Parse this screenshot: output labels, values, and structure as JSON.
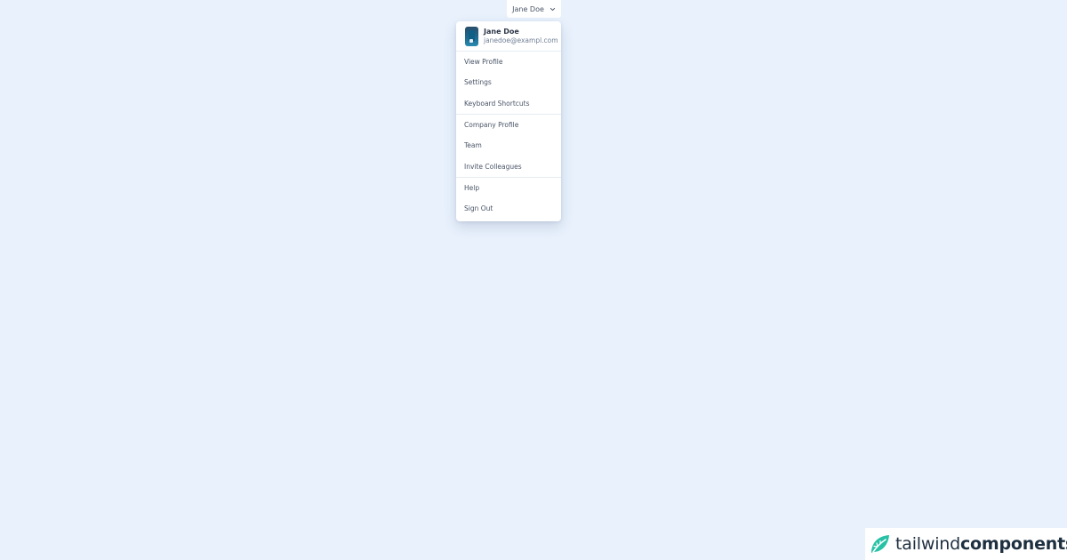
{
  "trigger": {
    "label": "Jane Doe",
    "icon": "chevron-down-icon"
  },
  "dropdown": {
    "user": {
      "name": "Jane Doe",
      "email": "janedoe@exampl.com"
    },
    "groups": [
      {
        "items": [
          {
            "label": "View Profile"
          },
          {
            "label": "Settings"
          },
          {
            "label": "Keyboard Shortcuts"
          }
        ]
      },
      {
        "items": [
          {
            "label": "Company Profile"
          },
          {
            "label": "Team"
          },
          {
            "label": "Invite Colleagues"
          }
        ]
      },
      {
        "items": [
          {
            "label": "Help"
          },
          {
            "label": "Sign Out"
          }
        ]
      }
    ]
  },
  "brand": {
    "part1": "tailwind",
    "part2": "components",
    "icon": "leaf-logo-icon"
  },
  "colors": {
    "background": "#e8f1fc",
    "brand_accent": "#27c1a5"
  }
}
